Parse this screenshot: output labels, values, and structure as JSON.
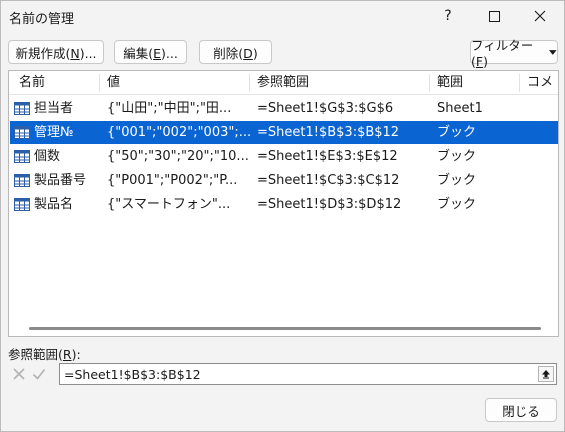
{
  "window": {
    "title": "名前の管理"
  },
  "toolbar": {
    "new_prefix": "新規作成(",
    "new_key": "N",
    "new_suffix": ")...",
    "edit_prefix": "編集(",
    "edit_key": "E",
    "edit_suffix": ")...",
    "delete_prefix": "削除(",
    "delete_key": "D",
    "delete_suffix": ")",
    "filter_prefix": "フィルター(",
    "filter_key": "F",
    "filter_suffix": ")"
  },
  "table": {
    "headers": {
      "name": "名前",
      "value": "値",
      "refers_to": "参照範囲",
      "scope": "範囲",
      "comment": "コメ"
    },
    "rows": [
      {
        "name": "担当者",
        "value": "{\"山田\";\"中田\";\"田...",
        "refers_to": "=Sheet1!$G$3:$G$6",
        "scope": "Sheet1",
        "selected": false
      },
      {
        "name": "管理№",
        "value": "{\"001\";\"002\";\"003\";...",
        "refers_to": "=Sheet1!$B$3:$B$12",
        "scope": "ブック",
        "selected": true
      },
      {
        "name": "個数",
        "value": "{\"50\";\"30\";\"20\";\"10...",
        "refers_to": "=Sheet1!$E$3:$E$12",
        "scope": "ブック",
        "selected": false
      },
      {
        "name": "製品番号",
        "value": "{\"P001\";\"P002\";\"P...",
        "refers_to": "=Sheet1!$C$3:$C$12",
        "scope": "ブック",
        "selected": false
      },
      {
        "name": "製品名",
        "value": "{\"スマートフォン\"...",
        "refers_to": "=Sheet1!$D$3:$D$12",
        "scope": "ブック",
        "selected": false
      }
    ]
  },
  "refers_to_field": {
    "label_prefix": "参照範囲(",
    "label_key": "R",
    "label_suffix": "):",
    "value": "=Sheet1!$B$3:$B$12"
  },
  "footer": {
    "close_label": "閉じる"
  },
  "colors": {
    "selection": "#0a64d2",
    "background": "#f3f3f3",
    "icon_blue": "#2b5fa8"
  },
  "icons": [
    "help-icon",
    "maximize-icon",
    "close-icon",
    "table-icon",
    "dropdown-arrow-icon",
    "cancel-icon",
    "enter-icon",
    "collapse-dialog-icon"
  ]
}
